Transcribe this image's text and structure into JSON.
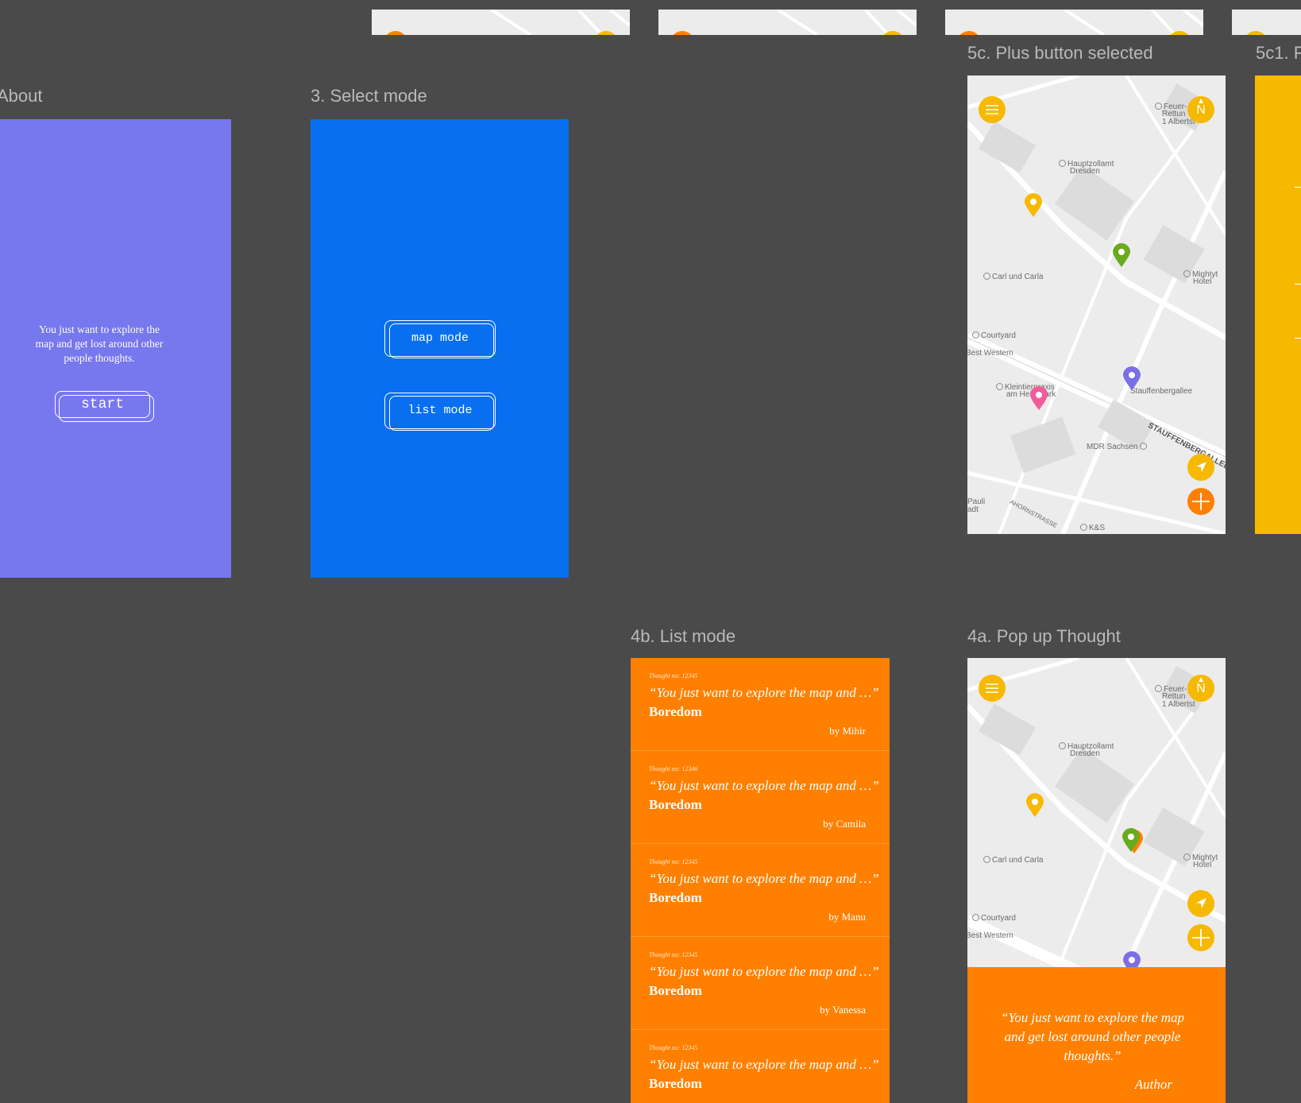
{
  "frames": {
    "about": {
      "label": "About",
      "text": "You just want to explore the map and get lost around other people thoughts.",
      "start_label": "start"
    },
    "select_mode": {
      "label": "3. Select mode",
      "map_mode_label": "map mode",
      "list_mode_label": "list mode"
    },
    "plus_selected": {
      "label": "5c. Plus button selected"
    },
    "partial": {
      "label": "5c1. F"
    },
    "list_mode": {
      "label": "4b. List mode",
      "cards": [
        {
          "no": "Thought no: 12345",
          "quote": "“You just want to explore the map and …”",
          "topic": "Boredom",
          "by": "by Mihir"
        },
        {
          "no": "Thought no: 12346",
          "quote": "“You just want to explore the map and …”",
          "topic": "Boredom",
          "by": "by Camila"
        },
        {
          "no": "Thought no: 12345",
          "quote": "“You just want to explore the map and …”",
          "topic": "Boredom",
          "by": "by Manu"
        },
        {
          "no": "Thought no: 12345",
          "quote": "“You just want to explore the map and …”",
          "topic": "Boredom",
          "by": "by Vanessa"
        },
        {
          "no": "Thought no: 12345",
          "quote": "“You just want to explore the map and …”",
          "topic": "Boredom",
          "by": ""
        }
      ]
    },
    "popup_thought": {
      "label": "4a. Pop up Thought",
      "quote": "“You just want to explore the map and get lost around other people thoughts.”",
      "author": "Author"
    }
  },
  "map_pois": {
    "feuer": "Feuer-",
    "rettung": "Rettun",
    "albertstadt": "1 Albertst",
    "hauptzollamt": "Hauptzollamt",
    "dresden": "Dresden",
    "carl_und_carla": "Carl und Carla",
    "mighty": "Mightyt",
    "hotel": "Hotel",
    "courtyard": "Courtyard",
    "best_western": "Best Western",
    "kleintier": "Kleintierpraxis",
    "am_heide": "am Heidepark",
    "stauffenbergallee_poi": "Stauffenbergallee",
    "street": "STAUFFENBERGALLEE",
    "mdr": "MDR Sachsen",
    "pauli": "Pauli",
    "adt": "adt",
    "ahorn": "AHORNSTRASSE",
    "ks": "K&S",
    "compass_n": "N"
  },
  "icons": {
    "menu": "hamburger-menu-icon",
    "compass": "compass-icon",
    "locate": "locate-arrow-icon",
    "plus": "plus-icon",
    "pin": "map-pin-icon"
  },
  "colors": {
    "canvas": "#4a4a4a",
    "about_bg": "#7777ee",
    "select_bg": "#0870f0",
    "orange": "#ff8000",
    "yellow": "#f7b900",
    "map_bg": "#ececec",
    "pin_yellow": "#f7b900",
    "pin_green": "#6aaa1e",
    "pin_purple": "#7a6fe6",
    "pin_pink": "#f25c9c"
  }
}
